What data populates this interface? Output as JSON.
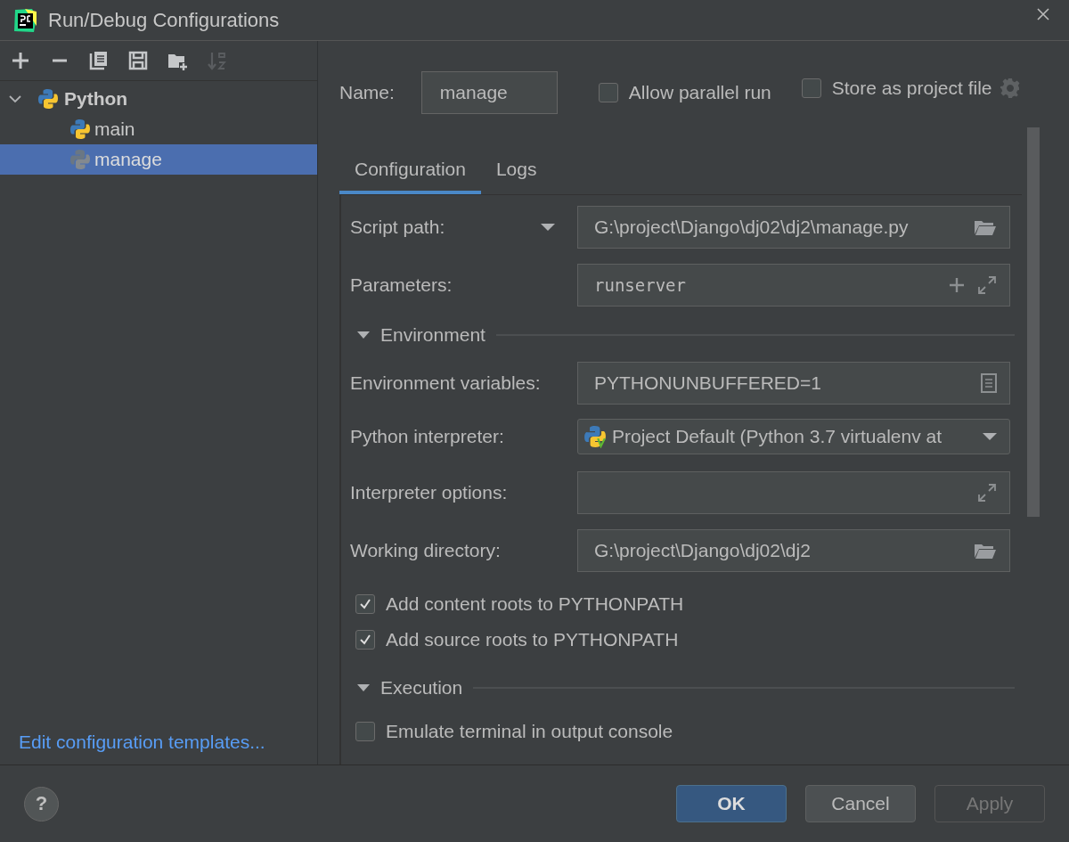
{
  "window": {
    "title": "Run/Debug Configurations"
  },
  "toolbar": [
    {
      "kind": "add",
      "disabled": false
    },
    {
      "kind": "remove",
      "disabled": false
    },
    {
      "kind": "copy",
      "disabled": false
    },
    {
      "kind": "save",
      "disabled": false
    },
    {
      "kind": "new-folder",
      "disabled": false
    },
    {
      "kind": "sort",
      "disabled": true
    }
  ],
  "tree": [
    {
      "label": "Python",
      "expanded": true,
      "selected": false,
      "temporary": false,
      "children": [
        {
          "label": "main",
          "selected": false,
          "temporary": false
        },
        {
          "label": "manage",
          "selected": true,
          "temporary": true
        }
      ]
    }
  ],
  "templates_link": "Edit configuration templates...",
  "name_field": {
    "label": "Name:",
    "value": "manage"
  },
  "options": [
    {
      "label": "Allow parallel run",
      "checked": false,
      "settings": false
    },
    {
      "label": "Store as project file",
      "checked": false,
      "settings": true
    }
  ],
  "tabs": [
    {
      "label": "Configuration",
      "selected": true
    },
    {
      "label": "Logs",
      "selected": false
    }
  ],
  "form": [
    {
      "kind": "path",
      "label": "Script path:",
      "value": "G:\\project\\Django\\dj02\\dj2\\manage.py",
      "dropdown": true
    },
    {
      "kind": "params",
      "label": "Parameters:",
      "value": "runserver"
    },
    {
      "kind": "section",
      "label": "Environment",
      "expanded": true
    },
    {
      "kind": "env",
      "label": "Environment variables:",
      "value": "PYTHONUNBUFFERED=1"
    },
    {
      "kind": "interpreter",
      "label": "Python interpreter:",
      "value": "Project Default (Python 3.7 virtualenv at"
    },
    {
      "kind": "options",
      "label": "Interpreter options:"
    },
    {
      "kind": "path",
      "label": "Working directory:",
      "value": "G:\\project\\Django\\dj02\\dj2",
      "dropdown": false
    },
    {
      "kind": "checkbox",
      "label": "Add content roots to PYTHONPATH",
      "checked": true
    },
    {
      "kind": "checkbox",
      "label": "Add source roots to PYTHONPATH",
      "checked": true
    },
    {
      "kind": "section",
      "label": "Execution",
      "expanded": true
    },
    {
      "kind": "checkbox",
      "label": "Emulate terminal in output console",
      "checked": false
    }
  ],
  "help": "?",
  "buttons": [
    {
      "label": "OK",
      "kind": "default",
      "disabled": false
    },
    {
      "label": "Cancel",
      "kind": "normal",
      "disabled": false
    },
    {
      "label": "Apply",
      "kind": "normal",
      "disabled": true
    }
  ]
}
